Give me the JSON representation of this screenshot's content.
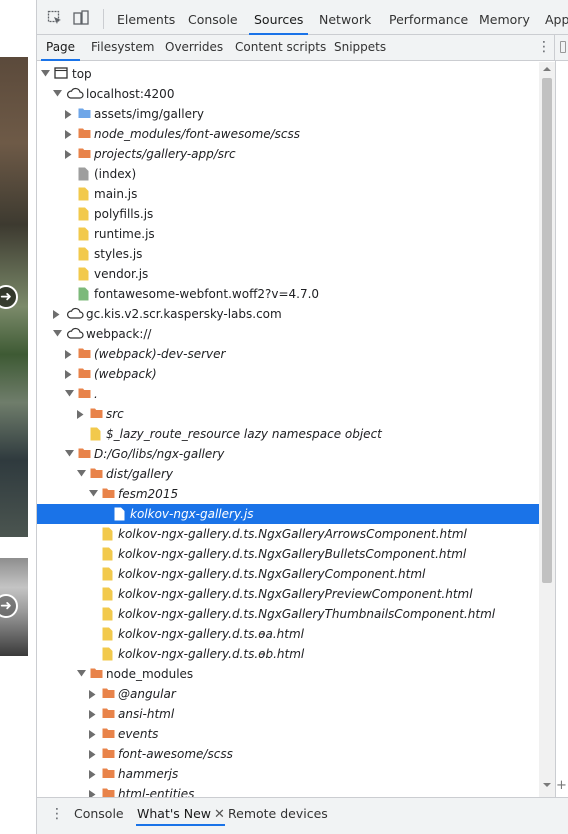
{
  "colors": {
    "accent": "#1a73e8",
    "folder_blue": "#6ea6e8",
    "folder_orange": "#e8834a",
    "file_yellow": "#f2c94c",
    "file_gray": "#9e9e9e",
    "file_green": "#7cb97a"
  },
  "toolbar": {
    "inspect_icon": "element-picker-icon",
    "device_icon": "device-toolbar-icon",
    "tabs": [
      "Elements",
      "Console",
      "Sources",
      "Network",
      "Performance",
      "Memory",
      "App"
    ],
    "active_tab": "Sources"
  },
  "navigator": {
    "tabs": [
      "Page",
      "Filesystem",
      "Overrides",
      "Content scripts",
      "Snippets"
    ],
    "active_tab": "Page",
    "more_icon": "kebab-menu-icon"
  },
  "tree": [
    {
      "label": "top",
      "depth": 0,
      "expand": "open",
      "icon": "frame",
      "italic": false
    },
    {
      "label": "localhost:4200",
      "depth": 1,
      "expand": "open",
      "icon": "cloud",
      "italic": false
    },
    {
      "label": "assets/img/gallery",
      "depth": 2,
      "expand": "closed",
      "icon": "folder-blue",
      "italic": false
    },
    {
      "label": "node_modules/font-awesome/scss",
      "depth": 2,
      "expand": "closed",
      "icon": "folder-orange",
      "italic": true
    },
    {
      "label": "projects/gallery-app/src",
      "depth": 2,
      "expand": "closed",
      "icon": "folder-orange",
      "italic": true
    },
    {
      "label": "(index)",
      "depth": 2,
      "expand": "none",
      "icon": "file-gray",
      "italic": false
    },
    {
      "label": "main.js",
      "depth": 2,
      "expand": "none",
      "icon": "file-yellow",
      "italic": false
    },
    {
      "label": "polyfills.js",
      "depth": 2,
      "expand": "none",
      "icon": "file-yellow",
      "italic": false
    },
    {
      "label": "runtime.js",
      "depth": 2,
      "expand": "none",
      "icon": "file-yellow",
      "italic": false
    },
    {
      "label": "styles.js",
      "depth": 2,
      "expand": "none",
      "icon": "file-yellow",
      "italic": false
    },
    {
      "label": "vendor.js",
      "depth": 2,
      "expand": "none",
      "icon": "file-yellow",
      "italic": false
    },
    {
      "label": "fontawesome-webfont.woff2?v=4.7.0",
      "depth": 2,
      "expand": "none",
      "icon": "file-green",
      "italic": false
    },
    {
      "label": "gc.kis.v2.scr.kaspersky-labs.com",
      "depth": 1,
      "expand": "closed",
      "icon": "cloud",
      "italic": false
    },
    {
      "label": "webpack://",
      "depth": 1,
      "expand": "open",
      "icon": "cloud",
      "italic": false
    },
    {
      "label": "(webpack)-dev-server",
      "depth": 2,
      "expand": "closed",
      "icon": "folder-orange",
      "italic": true
    },
    {
      "label": "(webpack)",
      "depth": 2,
      "expand": "closed",
      "icon": "folder-orange",
      "italic": true
    },
    {
      "label": ".",
      "depth": 2,
      "expand": "open",
      "icon": "folder-orange",
      "italic": true
    },
    {
      "label": "src",
      "depth": 3,
      "expand": "closed",
      "icon": "folder-orange",
      "italic": true
    },
    {
      "label": "$_lazy_route_resource lazy namespace object",
      "depth": 3,
      "expand": "none",
      "icon": "file-yellow",
      "italic": true
    },
    {
      "label": "D:/Go/libs/ngx-gallery",
      "depth": 2,
      "expand": "open",
      "icon": "folder-orange",
      "italic": true
    },
    {
      "label": "dist/gallery",
      "depth": 3,
      "expand": "open",
      "icon": "folder-orange",
      "italic": true
    },
    {
      "label": "fesm2015",
      "depth": 4,
      "expand": "open",
      "icon": "folder-orange",
      "italic": true
    },
    {
      "label": "kolkov-ngx-gallery.js",
      "depth": 5,
      "expand": "none",
      "icon": "file-yellow",
      "italic": true,
      "selected": true
    },
    {
      "label": "kolkov-ngx-gallery.d.ts.NgxGalleryArrowsComponent.html",
      "depth": 4,
      "expand": "none",
      "icon": "file-yellow",
      "italic": true
    },
    {
      "label": "kolkov-ngx-gallery.d.ts.NgxGalleryBulletsComponent.html",
      "depth": 4,
      "expand": "none",
      "icon": "file-yellow",
      "italic": true
    },
    {
      "label": "kolkov-ngx-gallery.d.ts.NgxGalleryComponent.html",
      "depth": 4,
      "expand": "none",
      "icon": "file-yellow",
      "italic": true
    },
    {
      "label": "kolkov-ngx-gallery.d.ts.NgxGalleryPreviewComponent.html",
      "depth": 4,
      "expand": "none",
      "icon": "file-yellow",
      "italic": true
    },
    {
      "label": "kolkov-ngx-gallery.d.ts.NgxGalleryThumbnailsComponent.html",
      "depth": 4,
      "expand": "none",
      "icon": "file-yellow",
      "italic": true
    },
    {
      "label": "kolkov-ngx-gallery.d.ts.ɵa.html",
      "depth": 4,
      "expand": "none",
      "icon": "file-yellow",
      "italic": true
    },
    {
      "label": "kolkov-ngx-gallery.d.ts.ɵb.html",
      "depth": 4,
      "expand": "none",
      "icon": "file-yellow",
      "italic": true
    },
    {
      "label": "node_modules",
      "depth": 3,
      "expand": "open",
      "icon": "folder-orange",
      "italic": false
    },
    {
      "label": "@angular",
      "depth": 4,
      "expand": "closed",
      "icon": "folder-orange",
      "italic": true
    },
    {
      "label": "ansi-html",
      "depth": 4,
      "expand": "closed",
      "icon": "folder-orange",
      "italic": true
    },
    {
      "label": "events",
      "depth": 4,
      "expand": "closed",
      "icon": "folder-orange",
      "italic": true
    },
    {
      "label": "font-awesome/scss",
      "depth": 4,
      "expand": "closed",
      "icon": "folder-orange",
      "italic": true
    },
    {
      "label": "hammerjs",
      "depth": 4,
      "expand": "closed",
      "icon": "folder-orange",
      "italic": true
    },
    {
      "label": "html-entities",
      "depth": 4,
      "expand": "closed",
      "icon": "folder-orange",
      "italic": true
    }
  ],
  "drawer": {
    "more_icon": "kebab-menu-icon",
    "tabs": [
      "Console",
      "What's New",
      "Remote devices"
    ],
    "active_tab": "What's New",
    "close_icon": "close-icon"
  }
}
